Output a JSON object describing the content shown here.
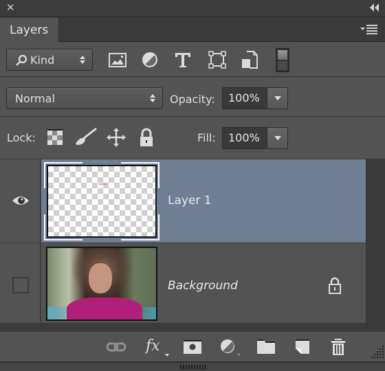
{
  "window": {
    "close_icon": "close-icon",
    "collapse_icon": "double-chevron-left-icon"
  },
  "tabs": [
    {
      "label": "Layers",
      "active": true
    }
  ],
  "panel_menu_icon": "panel-menu-icon",
  "filter": {
    "kind_label": "Kind",
    "kind_icon": "search-icon",
    "filter_icons": [
      "image-filter-icon",
      "adjustment-filter-icon",
      "type-filter-icon",
      "shape-filter-icon",
      "smart-object-filter-icon"
    ],
    "toggle_icon": "filter-toggle-icon"
  },
  "blend": {
    "mode": "Normal",
    "opacity_label": "Opacity:",
    "opacity_value": "100%"
  },
  "lock": {
    "label": "Lock:",
    "icons": [
      "lock-transparent-icon",
      "lock-image-icon",
      "lock-position-icon",
      "lock-all-icon"
    ],
    "fill_label": "Fill:",
    "fill_value": "100%"
  },
  "layers": [
    {
      "name": "Layer 1",
      "visible": true,
      "selected": true,
      "locked": false
    },
    {
      "name": "Background",
      "visible": false,
      "selected": false,
      "locked": true
    }
  ],
  "colors": {
    "selected_row": "#6f7d95",
    "panel_bg": "#535353"
  },
  "footer": {
    "buttons": [
      "link-layers-icon",
      "fx-icon",
      "add-mask-icon",
      "adjustment-layer-icon",
      "new-group-icon",
      "new-layer-icon",
      "delete-layer-icon"
    ],
    "fx_label": "fx"
  }
}
